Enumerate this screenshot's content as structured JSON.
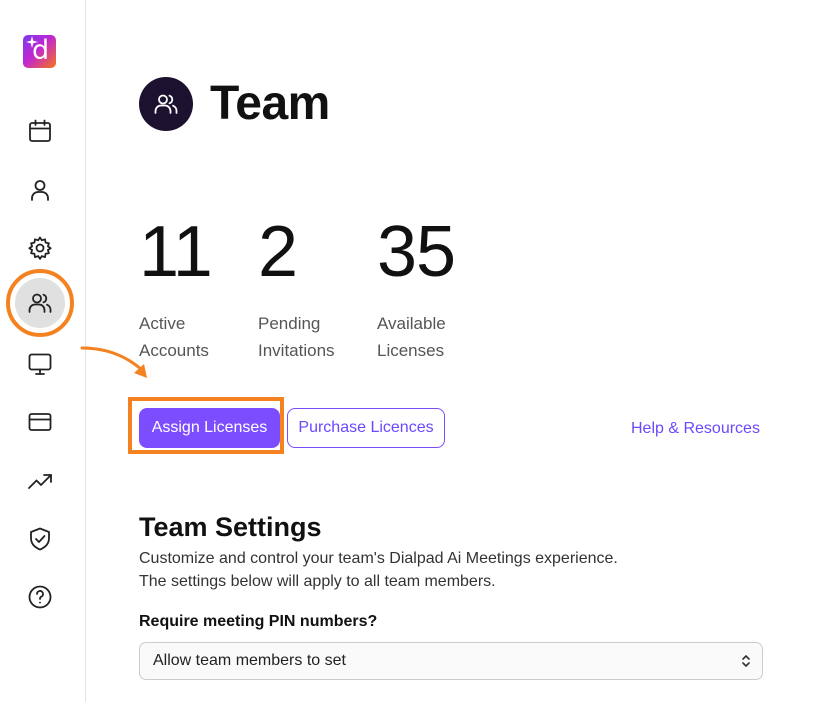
{
  "app": {
    "logo_letter": "d"
  },
  "sidebar": {
    "items": [
      {
        "name": "calendar"
      },
      {
        "name": "profile"
      },
      {
        "name": "settings"
      },
      {
        "name": "team",
        "active": true
      },
      {
        "name": "display"
      },
      {
        "name": "billing"
      },
      {
        "name": "analytics"
      },
      {
        "name": "security"
      },
      {
        "name": "help"
      }
    ]
  },
  "header": {
    "title": "Team",
    "icon": "team-icon"
  },
  "stats": [
    {
      "value": "11",
      "label_line1": "Active",
      "label_line2": "Accounts"
    },
    {
      "value": "2",
      "label_line1": "Pending",
      "label_line2": "Invitations"
    },
    {
      "value": "35",
      "label_line1": "Available",
      "label_line2": "Licenses"
    }
  ],
  "actions": {
    "assign_label": "Assign Licenses",
    "purchase_label": "Purchase Licences",
    "help_label": "Help & Resources"
  },
  "settings": {
    "title": "Team Settings",
    "desc_line1": "Customize and control your team's Dialpad Ai Meetings experience.",
    "desc_line2": "The settings below will apply to all team members.",
    "pin_label": "Require meeting PIN numbers?",
    "pin_value": "Allow team members to set"
  },
  "colors": {
    "accent": "#7c4dff",
    "highlight": "#f58220",
    "title_icon_bg": "#1c1230"
  }
}
